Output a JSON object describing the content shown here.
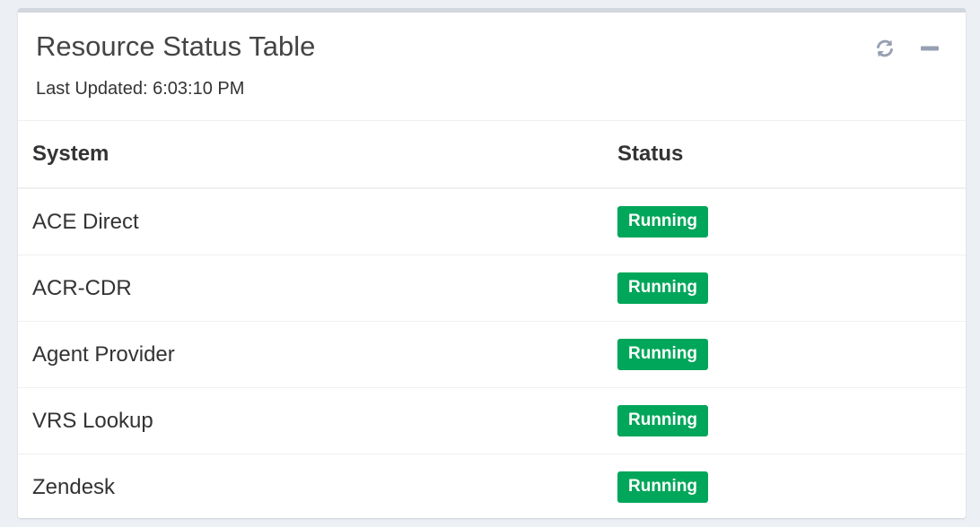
{
  "box": {
    "title": "Resource Status Table",
    "last_updated": "Last Updated: 6:03:10 PM",
    "tools": [
      {
        "icon": "refresh-icon"
      },
      {
        "icon": "minus-icon"
      }
    ]
  },
  "table": {
    "headers": [
      "System",
      "Status"
    ],
    "rows": [
      {
        "system": "ACE Direct",
        "status": "Running"
      },
      {
        "system": "ACR-CDR",
        "status": "Running"
      },
      {
        "system": "Agent Provider",
        "status": "Running"
      },
      {
        "system": "VRS Lookup",
        "status": "Running"
      },
      {
        "system": "Zendesk",
        "status": "Running"
      }
    ]
  },
  "colors": {
    "running": "#00a65a",
    "box_border": "#d2d6de",
    "icon": "#97a0b3"
  }
}
